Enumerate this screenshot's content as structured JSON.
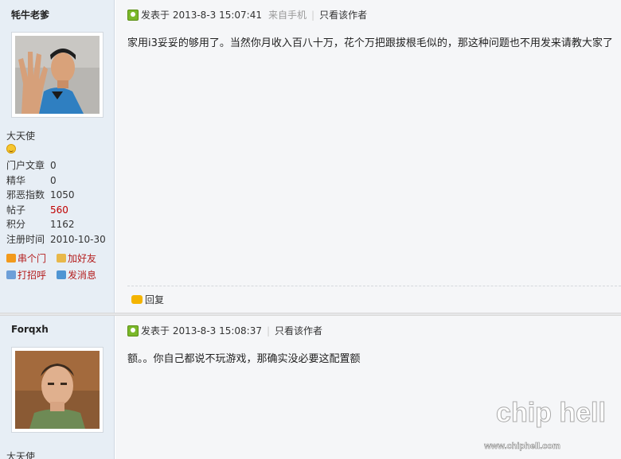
{
  "posts": [
    {
      "username": "牦牛老爹",
      "rank": "大天使",
      "stats": [
        {
          "label": "门户文章",
          "value": "0"
        },
        {
          "label": "精华",
          "value": "0"
        },
        {
          "label": "邪恶指数",
          "value": "1050"
        },
        {
          "label": "帖子",
          "value": "560"
        },
        {
          "label": "积分",
          "value": "1162"
        },
        {
          "label": "注册时间",
          "value": "2010-10-30"
        }
      ],
      "actions": {
        "visit": "串个门",
        "add_friend": "加好友",
        "greet": "打招呼",
        "message": "发消息"
      },
      "meta": {
        "posted": "发表于 2013-8-3 15:07:41",
        "via": "来自手机",
        "only_author": "只看该作者"
      },
      "content": "家用i3妥妥的够用了。当然你月收入百八十万，花个万把跟拔根毛似的，那这种问题也不用发来请教大家了",
      "reply": "回复"
    },
    {
      "username": "Forqxh",
      "rank": "大天使",
      "meta": {
        "posted": "发表于 2013-8-3 15:08:37",
        "only_author": "只看该作者"
      },
      "content": "额。。你自己都说不玩游戏，那确实没必要这配置额"
    }
  ],
  "watermark": {
    "logo": "chip hell",
    "url": "www.chiphell.com"
  },
  "colors": {
    "sidebar_bg": "#e7eef5",
    "main_bg": "#f5f6f8",
    "highlight_red": "#c00000",
    "action_red": "#b41e1e"
  }
}
